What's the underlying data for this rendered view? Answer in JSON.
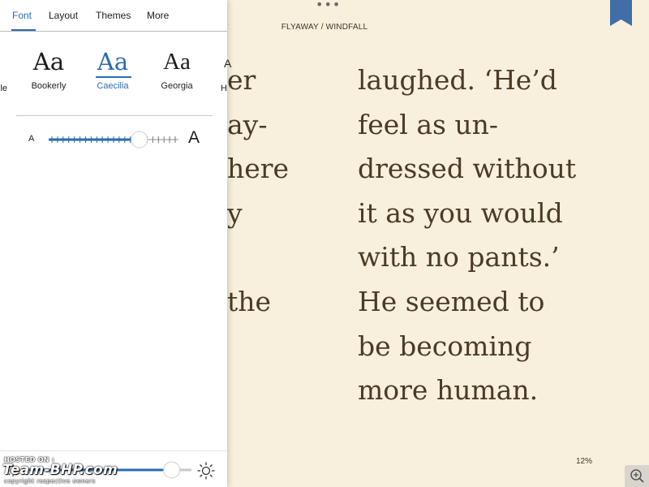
{
  "reader": {
    "top_indicator": "•••",
    "book_title": "FLYAWAY / WINDFALL",
    "left_column_lines": [
      "er",
      "ay-",
      "here",
      "y",
      "",
      "the"
    ],
    "right_column_lines": [
      "laughed. ‘He’d",
      "feel as un-",
      "dressed without",
      "it as you would",
      "with no pants.’",
      "He seemed to",
      "be becoming",
      "more human."
    ],
    "progress": "12%",
    "bookmark_icon": "bookmark-ribbon-icon",
    "zoom_icon": "zoom-in-icon"
  },
  "panel": {
    "tabs": [
      "Font",
      "Layout",
      "Themes",
      "More"
    ],
    "active_tab": "Font",
    "fonts": [
      {
        "sample": "Aa",
        "label": "Bookerly"
      },
      {
        "sample": "Aa",
        "label": "Caecilia"
      },
      {
        "sample": "Aa",
        "label": "Georgia"
      }
    ],
    "selected_font": "Caecilia",
    "partial_left_label": "lle",
    "partial_right_label": "H",
    "partial_right_sample": "A",
    "font_size": {
      "small_label": "A",
      "large_label": "A",
      "level": 0.72
    },
    "brightness": {
      "level": 0.92,
      "icon_small": "sun-small-icon",
      "icon_large": "sun-large-icon"
    }
  },
  "watermark": {
    "hosted": "HOSTED ON :",
    "brand": "Team-BHP.com",
    "copyright": "copyright respective owners"
  },
  "colors": {
    "accent": "#2a6bb0",
    "page_bg": "#f8f0dc",
    "text": "#4b3a25"
  }
}
